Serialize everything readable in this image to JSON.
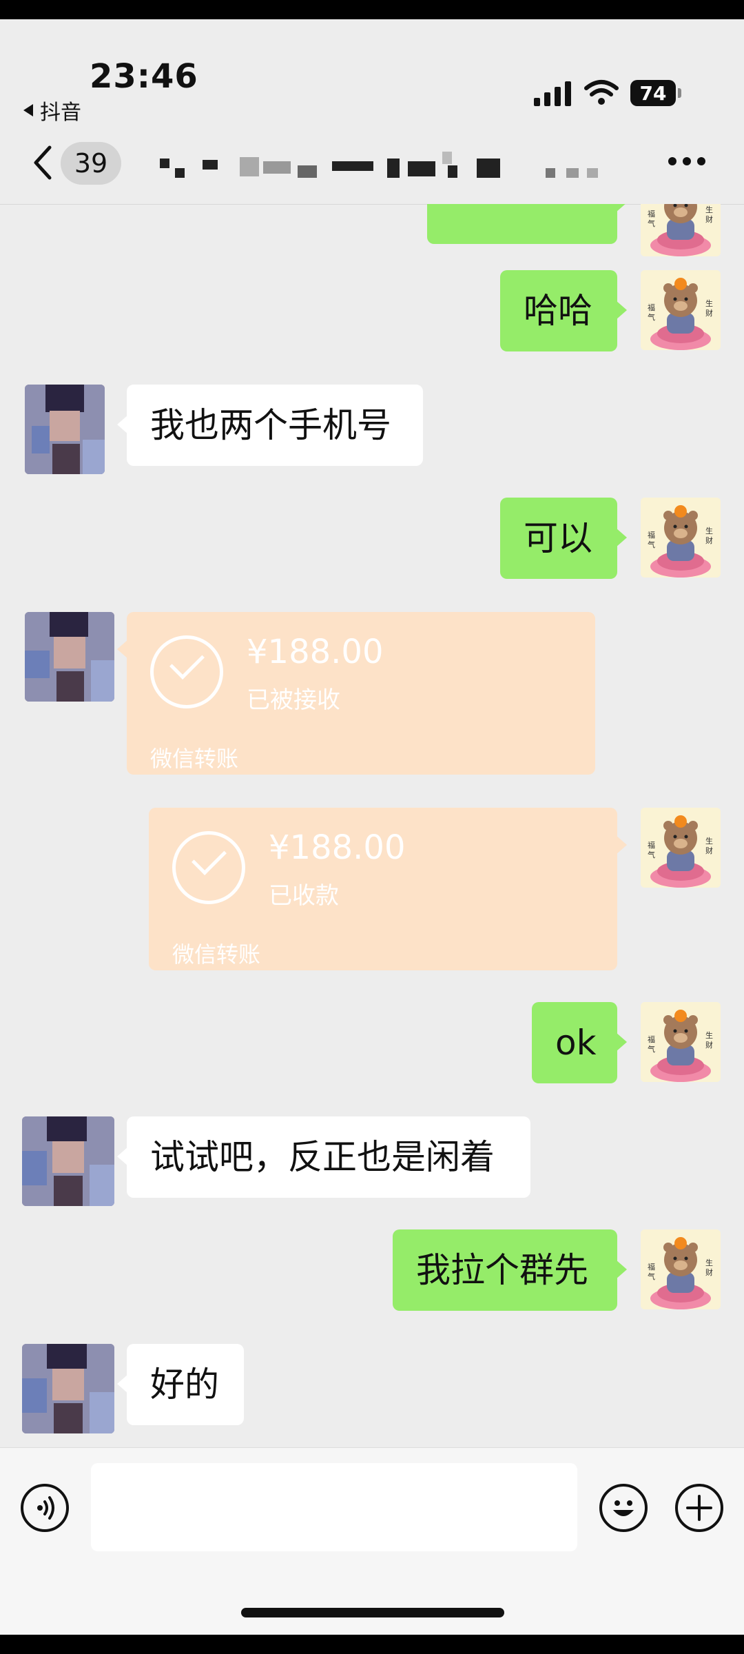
{
  "status_bar": {
    "time": "23:46",
    "back_app": "抖音",
    "battery": "74"
  },
  "nav": {
    "unread_count": "39",
    "chat_title": ""
  },
  "messages": [
    {
      "side": "me",
      "type": "text",
      "text": "哈哈"
    },
    {
      "side": "them",
      "type": "text",
      "text": "我也两个手机号"
    },
    {
      "side": "me",
      "type": "text",
      "text": "可以"
    },
    {
      "side": "them",
      "type": "transfer",
      "amount": "¥188.00",
      "status": "已被接收",
      "footer": "微信转账"
    },
    {
      "side": "me",
      "type": "transfer",
      "amount": "¥188.00",
      "status": "已收款",
      "footer": "微信转账"
    },
    {
      "side": "me",
      "type": "text",
      "text": "ok"
    },
    {
      "side": "them",
      "type": "text",
      "text": "试试吧，反正也是闲着"
    },
    {
      "side": "me",
      "type": "text",
      "text": "我拉个群先"
    },
    {
      "side": "them",
      "type": "text",
      "text": "好的"
    }
  ],
  "avatar_text": {
    "left": "福气",
    "right": "生财"
  },
  "colors": {
    "background": "#ededed",
    "my_bubble": "#95ec69",
    "their_bubble": "#ffffff",
    "transfer_card": "#fde2c8"
  },
  "icons": [
    "voice-icon",
    "emoji-icon",
    "plus-icon",
    "back-chevron-icon",
    "more-icon"
  ]
}
